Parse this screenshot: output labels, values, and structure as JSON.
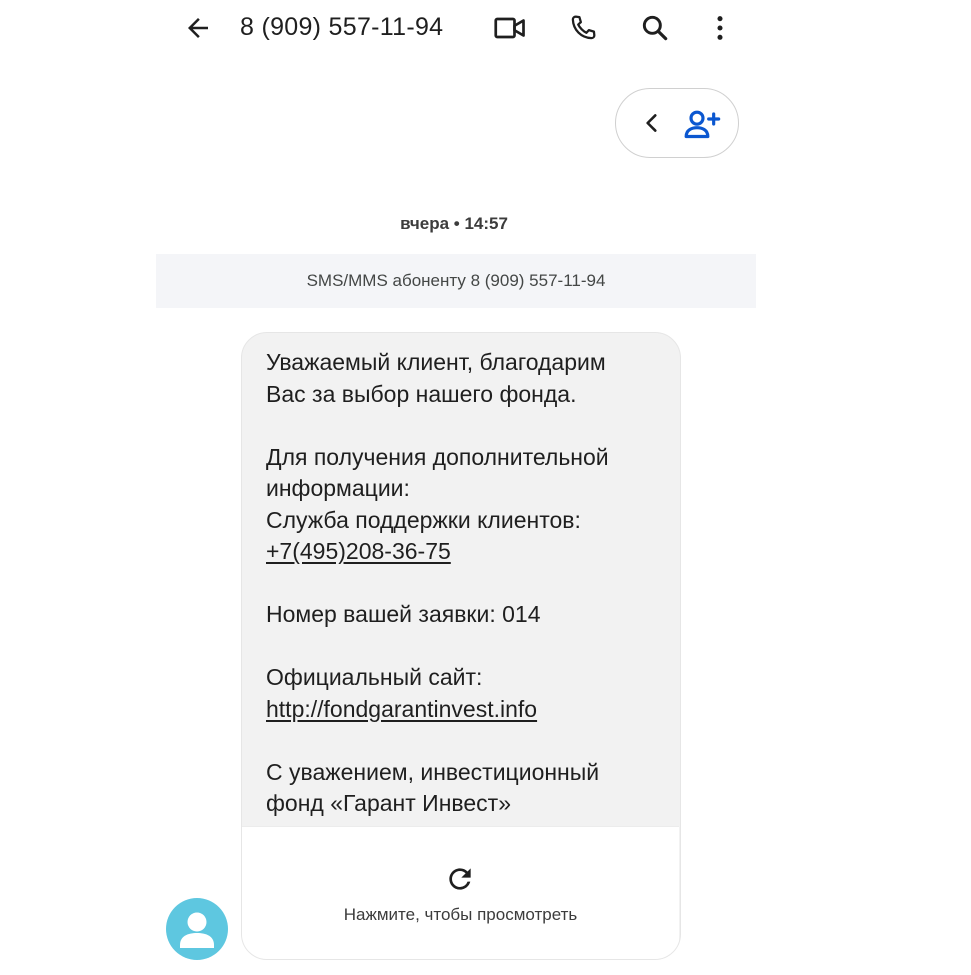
{
  "header": {
    "contact_title": "8 (909) 557-11-94",
    "icons": [
      "arrow-back-icon",
      "video-camera-icon",
      "phone-icon",
      "search-icon",
      "more-vert-icon"
    ]
  },
  "pill": {
    "icons": [
      "chevron-left-icon",
      "add-contact-icon"
    ],
    "accent_color": "#0b57d0"
  },
  "conversation": {
    "timestamp_day": "вчера",
    "timestamp_sep": "•",
    "timestamp_time": "14:57",
    "info_banner": "SMS/MMS абоненту 8 (909) 557-11-94"
  },
  "message": {
    "line_greeting_1": "Уважаемый клиент, благодарим",
    "line_greeting_2": "Вас за выбор нашего фонда.",
    "line_info_1": "Для получения дополнительной",
    "line_info_2": "информации:",
    "line_support": "Служба поддержки клиентов:",
    "support_phone": "+7(495)208-36-75",
    "request_number_line": "Номер вашей заявки: 014",
    "site_label": "Официальный сайт:",
    "site_url": "http://fondgarantinvest.info",
    "closing_1": "С уважением, инвестиционный",
    "closing_2": "фонд «Гарант Инвест»",
    "bubble_color": "#f2f2f2"
  },
  "mms_footer": {
    "refresh_icon": "refresh-icon",
    "tap_to_view": "Нажмите, чтобы просмотреть"
  },
  "avatar": {
    "icon": "person-icon",
    "color": "#5ec7e0"
  }
}
